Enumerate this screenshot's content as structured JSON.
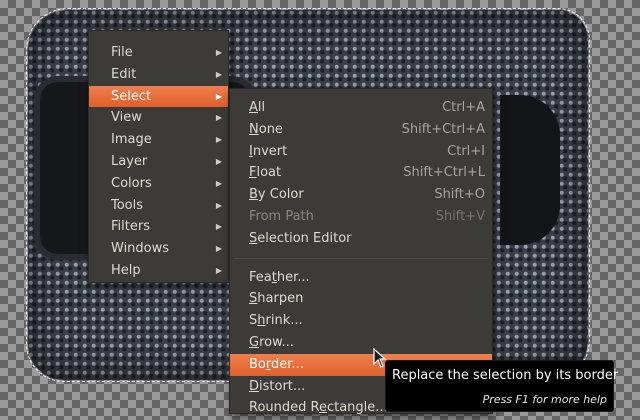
{
  "menubar": {
    "items": [
      {
        "label": "File"
      },
      {
        "label": "Edit"
      },
      {
        "label": "Select",
        "active": true
      },
      {
        "label": "View"
      },
      {
        "label": "Image"
      },
      {
        "label": "Layer"
      },
      {
        "label": "Colors"
      },
      {
        "label": "Tools"
      },
      {
        "label": "Filters"
      },
      {
        "label": "Windows"
      },
      {
        "label": "Help"
      }
    ],
    "submenu_arrow_icon": "submenu-arrow-icon"
  },
  "select_menu": {
    "group1": [
      {
        "mnemonic": "A",
        "rest": "ll",
        "accel": "Ctrl+A"
      },
      {
        "mnemonic": "N",
        "rest": "one",
        "accel": "Shift+Ctrl+A"
      },
      {
        "mnemonic": "I",
        "rest": "nvert",
        "accel": "Ctrl+I"
      },
      {
        "mnemonic": "F",
        "rest": "loat",
        "accel": "Shift+Ctrl+L"
      },
      {
        "mnemonic": "B",
        "rest": "y Color",
        "accel": "Shift+O"
      },
      {
        "label": "From Path",
        "accel": "Shift+V",
        "disabled": true
      },
      {
        "mnemonic": "S",
        "rest": "election Editor",
        "accel": ""
      }
    ],
    "group2": [
      {
        "pre": "Fea",
        "mnemonic": "t",
        "rest": "her..."
      },
      {
        "mnemonic": "S",
        "rest": "harpen"
      },
      {
        "pre": "S",
        "mnemonic": "h",
        "rest": "rink..."
      },
      {
        "mnemonic": "G",
        "rest": "row..."
      },
      {
        "pre": "Bo",
        "mnemonic": "r",
        "rest": "der...",
        "active": true
      },
      {
        "mnemonic": "D",
        "rest": "istort..."
      },
      {
        "pre": "Rounded R",
        "mnemonic": "e",
        "rest": "ctangle..."
      }
    ]
  },
  "tooltip": {
    "text": "Replace the selection by its border",
    "help": "Press F1 for more help"
  },
  "colors": {
    "menu_bg": "#3c3b37",
    "highlight": "#e8692f",
    "text": "#dfdbd2"
  }
}
